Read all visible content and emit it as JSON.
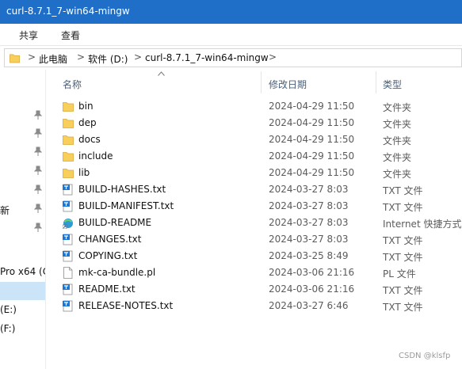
{
  "window": {
    "title": "curl-8.7.1_7-win64-mingw"
  },
  "ribbon": {
    "tabs": [
      "共享",
      "查看"
    ]
  },
  "address": {
    "crumbs": [
      "此电脑",
      "软件 (D:)",
      "curl-8.7.1_7-win64-mingw"
    ],
    "separator": ">"
  },
  "nav": {
    "pins": 7,
    "labels": [
      "新",
      "",
      "Pro x64 (C",
      "",
      "(E:)",
      "(F:)"
    ]
  },
  "columns": {
    "name": "名称",
    "modified": "修改日期",
    "type": "类型"
  },
  "files": [
    {
      "name": "bin",
      "date": "2024-04-29 11:50",
      "type": "文件夹",
      "icon": "folder-icon"
    },
    {
      "name": "dep",
      "date": "2024-04-29 11:50",
      "type": "文件夹",
      "icon": "folder-icon"
    },
    {
      "name": "docs",
      "date": "2024-04-29 11:50",
      "type": "文件夹",
      "icon": "folder-icon"
    },
    {
      "name": "include",
      "date": "2024-04-29 11:50",
      "type": "文件夹",
      "icon": "folder-icon"
    },
    {
      "name": "lib",
      "date": "2024-04-29 11:50",
      "type": "文件夹",
      "icon": "folder-icon"
    },
    {
      "name": "BUILD-HASHES.txt",
      "date": "2024-03-27 8:03",
      "type": "TXT 文件",
      "icon": "text-file-icon"
    },
    {
      "name": "BUILD-MANIFEST.txt",
      "date": "2024-03-27 8:03",
      "type": "TXT 文件",
      "icon": "text-file-icon"
    },
    {
      "name": "BUILD-README",
      "date": "2024-03-27 8:03",
      "type": "Internet 快捷方式",
      "icon": "internet-shortcut-icon"
    },
    {
      "name": "CHANGES.txt",
      "date": "2024-03-27 8:03",
      "type": "TXT 文件",
      "icon": "text-file-icon"
    },
    {
      "name": "COPYING.txt",
      "date": "2024-03-25 8:49",
      "type": "TXT 文件",
      "icon": "text-file-icon"
    },
    {
      "name": "mk-ca-bundle.pl",
      "date": "2024-03-06 21:16",
      "type": "PL 文件",
      "icon": "generic-file-icon"
    },
    {
      "name": "README.txt",
      "date": "2024-03-06 21:16",
      "type": "TXT 文件",
      "icon": "text-file-icon"
    },
    {
      "name": "RELEASE-NOTES.txt",
      "date": "2024-03-27 6:46",
      "type": "TXT 文件",
      "icon": "text-file-icon"
    }
  ],
  "watermark": "CSDN @klsfp",
  "colors": {
    "titlebar": "#1f6fc9",
    "folder": "#f7cf5a",
    "selection": "#cce4f7"
  }
}
